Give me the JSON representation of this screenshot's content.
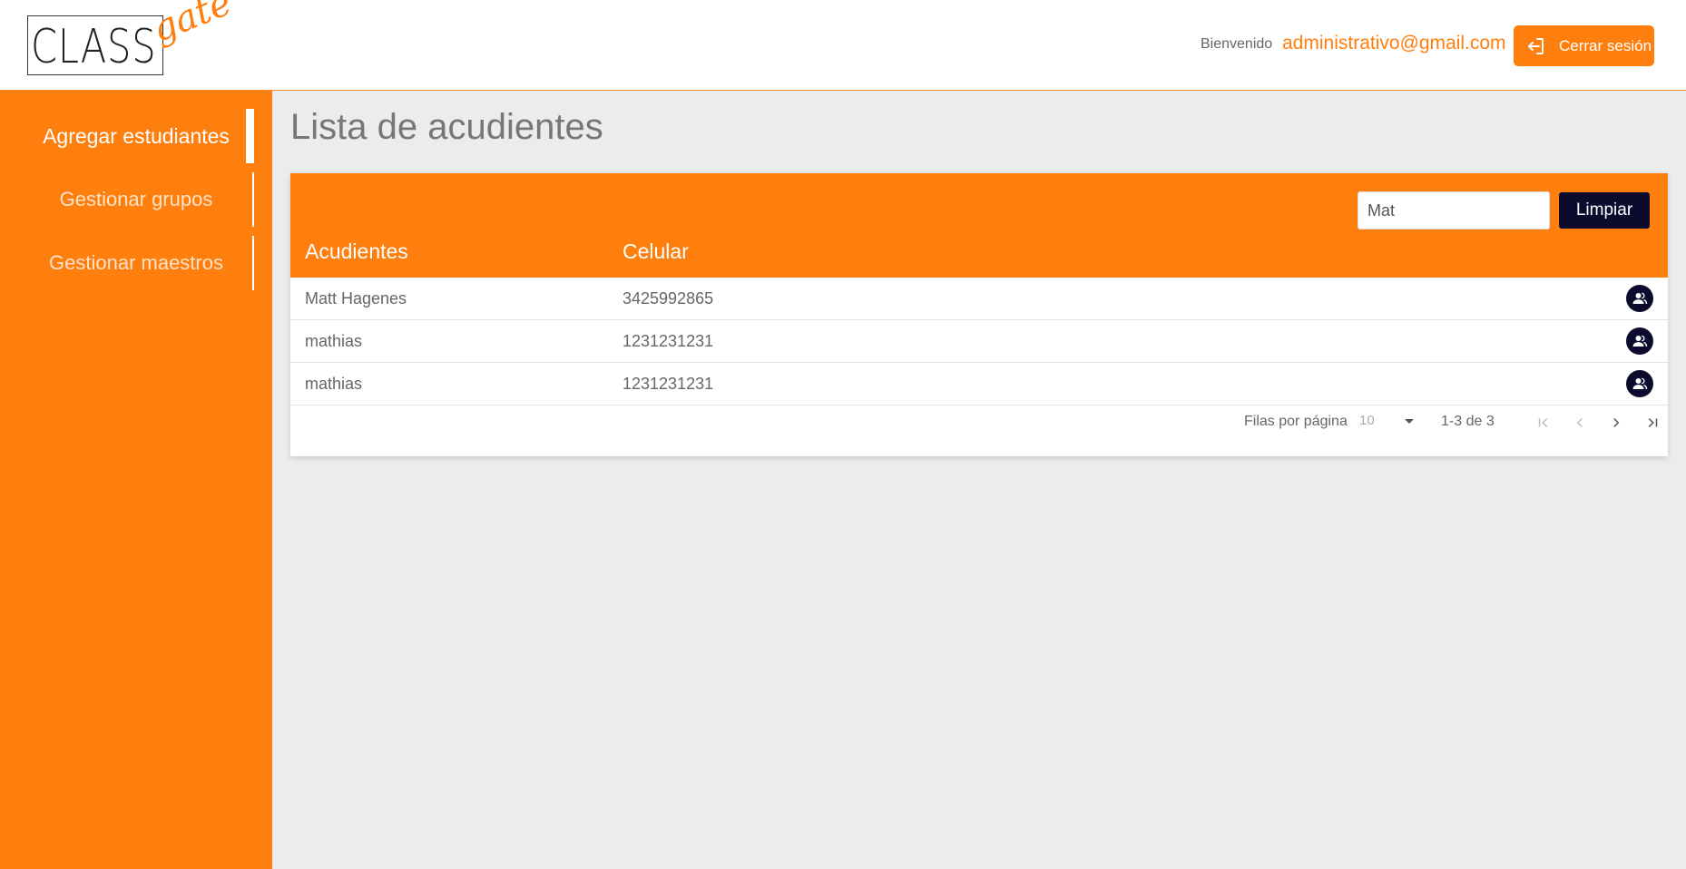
{
  "header": {
    "logo_main": "CLASS",
    "logo_script": "gate",
    "welcome": "Bienvenido",
    "email": "administrativo@gmail.com",
    "logout_label": "Cerrar sesión"
  },
  "sidebar": {
    "items": [
      {
        "label": "Agregar estudiantes",
        "active": true
      },
      {
        "label": "Gestionar grupos",
        "active": false
      },
      {
        "label": "Gestionar maestros",
        "active": false
      }
    ]
  },
  "main": {
    "title": "Lista de acudientes",
    "search": {
      "value": "Mat"
    },
    "clear_label": "Limpiar",
    "columns": [
      "Acudientes",
      "Celular"
    ],
    "rows": [
      {
        "name": "Matt Hagenes",
        "phone": "3425992865",
        "action_icon": "user-group-icon"
      },
      {
        "name": "mathias",
        "phone": "1231231231",
        "action_icon": "user-group-icon"
      },
      {
        "name": "mathias",
        "phone": "1231231231",
        "action_icon": "user-group-icon"
      }
    ],
    "pagination": {
      "rows_label": "Filas por página",
      "rows_per_page": "10",
      "range": "1-3 de 3"
    }
  },
  "colors": {
    "accent": "#ff7f0e",
    "dark": "#0c0b2e",
    "background": "#ececec"
  }
}
